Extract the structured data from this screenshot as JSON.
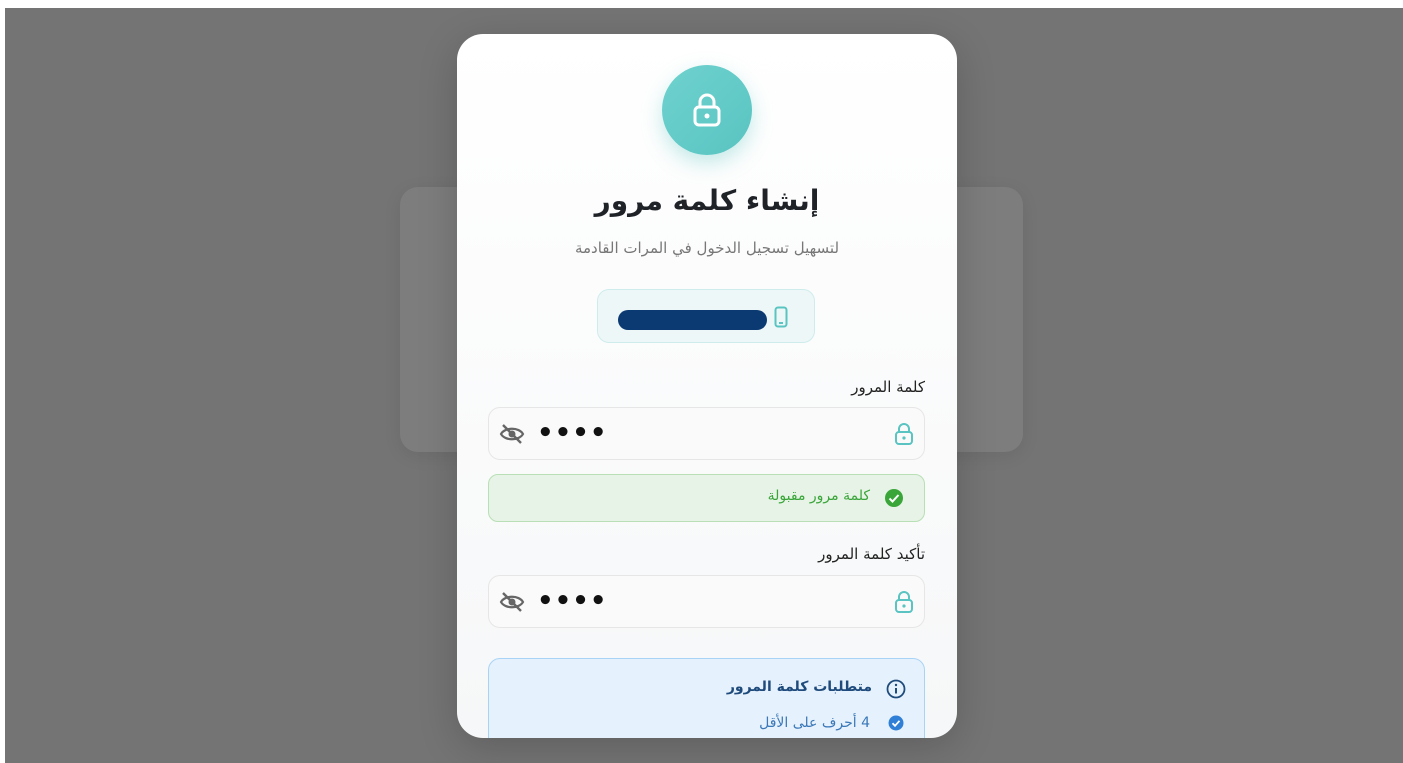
{
  "dialog": {
    "title": "إنشاء كلمة مرور",
    "subtitle": "لتسهيل تسجيل الدخول في المرات القادمة",
    "phone_icon": "mobile-phone-icon"
  },
  "password": {
    "label": "كلمة المرور",
    "value": "••••"
  },
  "validation": {
    "message": "كلمة مرور مقبولة",
    "color": "#3aa63a"
  },
  "confirm": {
    "label": "تأكيد كلمة المرور",
    "value": "••••"
  },
  "requirements": {
    "title": "متطلبات كلمة المرور",
    "items": [
      "4 أحرف على الأقل"
    ]
  },
  "colors": {
    "accent": "#59c4c1",
    "success": "#3aa63a",
    "info": "#2f7fd6"
  }
}
